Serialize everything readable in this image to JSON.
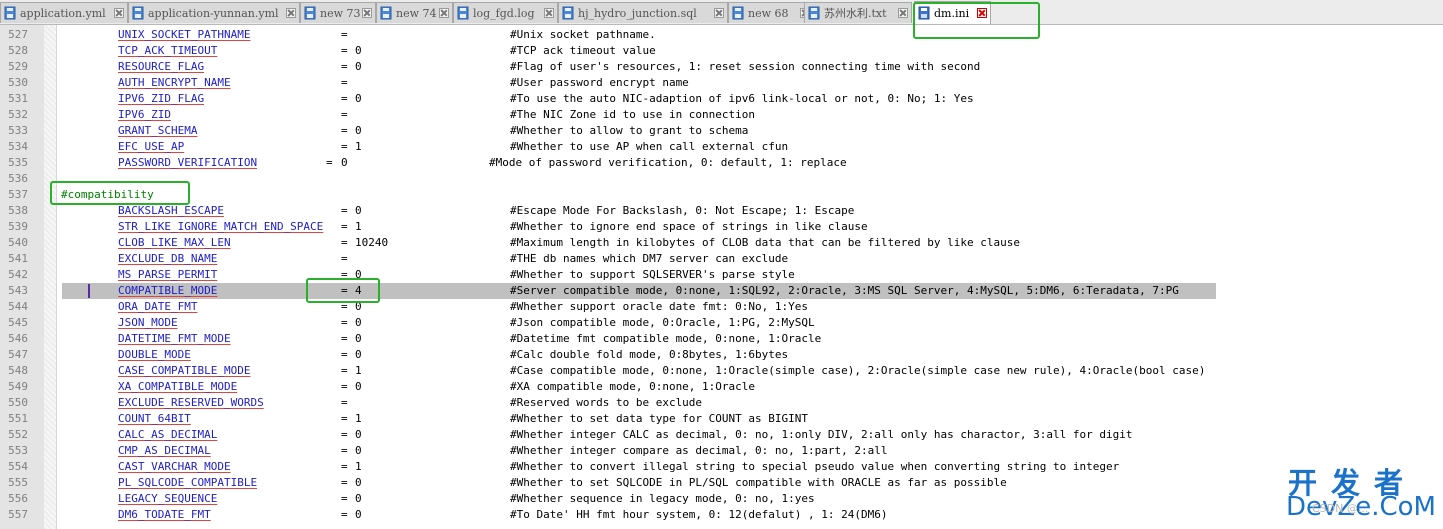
{
  "tabs": [
    {
      "label": "application.yml",
      "active": false
    },
    {
      "label": "application-yunnan.yml",
      "active": false
    },
    {
      "label": "new 73",
      "active": false
    },
    {
      "label": "new 74",
      "active": false
    },
    {
      "label": "log_fgd.log",
      "active": false
    },
    {
      "label": "hj_hydro_junction.sql",
      "active": false
    },
    {
      "label": "new 68",
      "active": false
    },
    {
      "label": "苏州水利.txt",
      "active": false
    },
    {
      "label": "dm.ini",
      "active": true
    }
  ],
  "editor": {
    "lines": [
      {
        "num": "527",
        "key": "UNIX_SOCKET_PATHNAME",
        "eq": "=",
        "val": "",
        "comment": "#Unix socket pathname."
      },
      {
        "num": "528",
        "key": "TCP_ACK_TIMEOUT",
        "eq": "=",
        "val": "0",
        "comment": "#TCP ack timeout value"
      },
      {
        "num": "529",
        "key": "RESOURCE_FLAG",
        "eq": "=",
        "val": "0",
        "comment": "#Flag of user's resources, 1: reset session connecting time with second"
      },
      {
        "num": "530",
        "key": "AUTH_ENCRYPT_NAME",
        "eq": "=",
        "val": "",
        "comment": "#User password encrypt name"
      },
      {
        "num": "531",
        "key": "IPV6_ZID_FLAG",
        "eq": "=",
        "val": "0",
        "comment": "#To use the auto NIC-adaption of ipv6 link-local or not, 0: No; 1: Yes"
      },
      {
        "num": "532",
        "key": "IPV6_ZID",
        "eq": "=",
        "val": "",
        "comment": "#The NIC Zone id to use in connection"
      },
      {
        "num": "533",
        "key": "GRANT_SCHEMA",
        "eq": "=",
        "val": "0",
        "comment": "#Whether to allow to grant to schema"
      },
      {
        "num": "534",
        "key": "EFC_USE_AP",
        "eq": "=",
        "val": "1",
        "comment": "#Whether to use AP when call external cfun"
      },
      {
        "num": "535",
        "key": "PASSWORD_VERIFICATION",
        "eq": "=",
        "val": "0",
        "comment": "#Mode of password verification, 0: default, 1: replace",
        "shifted": true
      },
      {
        "num": "536",
        "key": "",
        "eq": "",
        "val": "",
        "comment": ""
      },
      {
        "num": "537",
        "section": "#compatibility"
      },
      {
        "num": "538",
        "key": "BACKSLASH_ESCAPE",
        "eq": "=",
        "val": "0",
        "comment": "#Escape Mode For Backslash, 0: Not Escape; 1: Escape"
      },
      {
        "num": "539",
        "key": "STR_LIKE_IGNORE_MATCH_END_SPACE",
        "eq": "=",
        "val": "1",
        "comment": "#Whether to ignore end space of strings in like clause"
      },
      {
        "num": "540",
        "key": "CLOB_LIKE_MAX_LEN",
        "eq": "=",
        "val": "10240",
        "comment": "#Maximum length in kilobytes of CLOB data that can be filtered by like clause"
      },
      {
        "num": "541",
        "key": "EXCLUDE_DB_NAME",
        "eq": "=",
        "val": "",
        "comment": "#THE db names which DM7 server can exclude"
      },
      {
        "num": "542",
        "key": "MS_PARSE_PERMIT",
        "eq": "=",
        "val": "0",
        "comment": "#Whether to support SQLSERVER's parse style"
      },
      {
        "num": "543",
        "key": "COMPATIBLE_MODE",
        "eq": "=",
        "val": "4",
        "comment": "#Server compatible mode, 0:none, 1:SQL92, 2:Oracle, 3:MS SQL Server, 4:MySQL, 5:DM6, 6:Teradata, 7:PG",
        "highlight": true
      },
      {
        "num": "544",
        "key": "ORA_DATE_FMT",
        "eq": "=",
        "val": "0",
        "comment": "#Whether support oracle date fmt: 0:No, 1:Yes"
      },
      {
        "num": "545",
        "key": "JSON_MODE",
        "eq": "=",
        "val": "0",
        "comment": "#Json compatible mode, 0:Oracle, 1:PG, 2:MySQL"
      },
      {
        "num": "546",
        "key": "DATETIME_FMT_MODE",
        "eq": "=",
        "val": "0",
        "comment": "#Datetime fmt compatible mode, 0:none, 1:Oracle"
      },
      {
        "num": "547",
        "key": "DOUBLE_MODE",
        "eq": "=",
        "val": "0",
        "comment": "#Calc double fold mode, 0:8bytes, 1:6bytes"
      },
      {
        "num": "548",
        "key": "CASE_COMPATIBLE_MODE",
        "eq": "=",
        "val": "1",
        "comment": "#Case compatible mode, 0:none, 1:Oracle(simple case), 2:Oracle(simple case new rule), 4:Oracle(bool case)"
      },
      {
        "num": "549",
        "key": "XA_COMPATIBLE_MODE",
        "eq": "=",
        "val": "0",
        "comment": "#XA compatible mode, 0:none, 1:Oracle"
      },
      {
        "num": "550",
        "key": "EXCLUDE_RESERVED_WORDS",
        "eq": "=",
        "val": "",
        "comment": "#Reserved words to be exclude"
      },
      {
        "num": "551",
        "key": "COUNT_64BIT",
        "eq": "=",
        "val": "1",
        "comment": "#Whether to set data type for COUNT as BIGINT"
      },
      {
        "num": "552",
        "key": "CALC_AS_DECIMAL",
        "eq": "=",
        "val": "0",
        "comment": "#Whether integer CALC as decimal, 0: no, 1:only DIV, 2:all only has charactor, 3:all for digit"
      },
      {
        "num": "553",
        "key": "CMP_AS_DECIMAL",
        "eq": "=",
        "val": "0",
        "comment": "#Whether integer compare as decimal, 0: no, 1:part, 2:all"
      },
      {
        "num": "554",
        "key": "CAST_VARCHAR_MODE",
        "eq": "=",
        "val": "1",
        "comment": "#Whether to convert illegal string to special pseudo value when converting string to integer"
      },
      {
        "num": "555",
        "key": "PL_SQLCODE_COMPATIBLE",
        "eq": "=",
        "val": "0",
        "comment": "#Whether to set SQLCODE in PL/SQL compatible with ORACLE as far as possible"
      },
      {
        "num": "556",
        "key": "LEGACY_SEQUENCE",
        "eq": "=",
        "val": "0",
        "comment": "#Whether sequence in legacy mode, 0: no, 1:yes"
      },
      {
        "num": "557",
        "key": "DM6_TODATE_FMT",
        "eq": "=",
        "val": "0",
        "comment": "#To Date' HH fmt hour system, 0: 12(defalut) , 1: 24(DM6)"
      }
    ]
  },
  "watermark": {
    "brand_cn": "开发者",
    "brand_en": "DevZe.CoM",
    "sub": "CSDN @..."
  },
  "colors": {
    "callout": "#2ab02a",
    "key": "#1e1ec8",
    "section": "#008000",
    "highlight": "#c0c0c0"
  }
}
